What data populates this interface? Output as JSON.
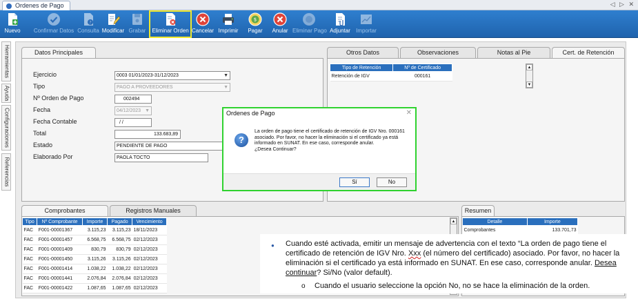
{
  "window": {
    "tab_title": "Ordenes de Pago",
    "nav_arrows": "◁ ▷ ✕"
  },
  "toolbar": [
    {
      "label": "Nuevo",
      "icon": "new-doc-icon",
      "disabled": false
    },
    {
      "label": "Confirmar Datos",
      "icon": "check-circle-icon",
      "disabled": true
    },
    {
      "label": "Consulta",
      "icon": "query-doc-icon",
      "disabled": true
    },
    {
      "label": "Modificar",
      "icon": "edit-doc-icon",
      "disabled": false
    },
    {
      "label": "Grabar",
      "icon": "save-icon",
      "disabled": true
    },
    {
      "label": "Eliminar Orden",
      "icon": "delete-doc-icon",
      "disabled": false
    },
    {
      "label": "Cancelar",
      "icon": "cancel-icon",
      "disabled": false
    },
    {
      "label": "Imprimir",
      "icon": "printer-icon",
      "disabled": false
    },
    {
      "label": "Pagar",
      "icon": "pay-coins-icon",
      "disabled": false
    },
    {
      "label": "Anular",
      "icon": "annul-icon",
      "disabled": false
    },
    {
      "label": "Eliminar Pago",
      "icon": "delete-payment-icon",
      "disabled": true
    },
    {
      "label": "Adjuntar",
      "icon": "attach-doc-icon",
      "disabled": false
    },
    {
      "label": "Importar",
      "icon": "import-chart-icon",
      "disabled": true
    }
  ],
  "side_tabs": [
    "Herramientas",
    "Ayuda",
    "Configuraciones",
    "Referencias"
  ],
  "datos_principales": {
    "tab_label": "Datos Principales",
    "ejercicio_label": "Ejercicio",
    "ejercicio_value": "0003 01/01/2023-31/12/2023",
    "tipo_label": "Tipo",
    "tipo_value": "PAGO A PROVEEDORES",
    "nro_orden_label": "Nº Orden de Pago",
    "nro_orden_value": "002494",
    "fecha_label": "Fecha",
    "fecha_value": "04/12/2023",
    "fecha_contable_label": "Fecha Contable",
    "fecha_contable_value": " /  /",
    "total_label": "Total",
    "total_value": "133.683,89",
    "estado_label": "Estado",
    "estado_value": "PENDIENTE DE PAGO",
    "elaborado_label": "Elaborado Por",
    "elaborado_value": "PAOLA TOCTO"
  },
  "right_tabs": [
    "Otros Datos",
    "Observaciones",
    "Notas al Pie",
    "Cert. de Retención"
  ],
  "retencion_grid": {
    "headers": [
      "Tipo de Retención",
      "Nº de Certificado"
    ],
    "rows": [
      [
        "Retención de IGV",
        "000161"
      ]
    ]
  },
  "bottom_tabs": [
    "Comprobantes",
    "Registros Manuales"
  ],
  "comprobantes_grid": {
    "headers": [
      "Tipo",
      "Nº Comprobante",
      "Importe",
      "Pagado",
      "Vencimiento"
    ],
    "rows": [
      [
        "FAC",
        "F001-00001367",
        "3.115,23",
        "3.115,23",
        "18/11/2023"
      ],
      [
        "FAC",
        "F001-00001457",
        "6.568,75",
        "6.568,75",
        "02/12/2023"
      ],
      [
        "FAC",
        "F001-00001409",
        "830,79",
        "830,79",
        "02/12/2023"
      ],
      [
        "FAC",
        "F001-00001450",
        "3.115,26",
        "3.115,26",
        "02/12/2023"
      ],
      [
        "FAC",
        "F001-00001414",
        "1.038,22",
        "1.038,22",
        "02/12/2023"
      ],
      [
        "FAC",
        "F001-00001441",
        "2.076,84",
        "2.076,84",
        "02/12/2023"
      ],
      [
        "FAC",
        "F001-00001422",
        "1.087,65",
        "1.087,65",
        "02/12/2023"
      ]
    ]
  },
  "resumen": {
    "tab_label": "Resumen",
    "headers": [
      "Detalle",
      "Importe"
    ],
    "rows": [
      [
        "Comprobantes",
        "133.701,73"
      ]
    ]
  },
  "dialog": {
    "title": "Ordenes de Pago",
    "close_glyph": "✕",
    "icon_glyph": "?",
    "message_1": "La orden de pago tiene el certificado de retención de IGV Nro. 000161 asociado. Por favor, no hacer la eliminación si el certificado ya está informado en SUNAT. En ese caso, corresponde anular.",
    "message_2": "¿Desea Continuar?",
    "yes_label": "Sí",
    "no_label": "No"
  },
  "note": {
    "bullet": "●",
    "line_a": "Cuando esté activada, emitir un mensaje de advertencia con el texto “La orden de pago tiene el certificado de retención de IGV Nro. ",
    "xxx": "Xxx",
    "line_b": " (el número del certificado) asociado. Por favor, no hacer la eliminación si el certificado ya está informado en SUNAT. En ese caso, corresponde anular. ",
    "desea": "Desea continuar",
    "line_c": "? Si/No (valor default).",
    "sub_bullet": "o",
    "sub_text": "Cuando el usuario seleccione la opción No, no se hace la eliminación de la orden."
  },
  "colors": {
    "toolbar": "#2f7fcf",
    "grid_header": "#2a6fbd",
    "dialog_border": "#2fd22f",
    "highlight": "#f1e92c"
  }
}
